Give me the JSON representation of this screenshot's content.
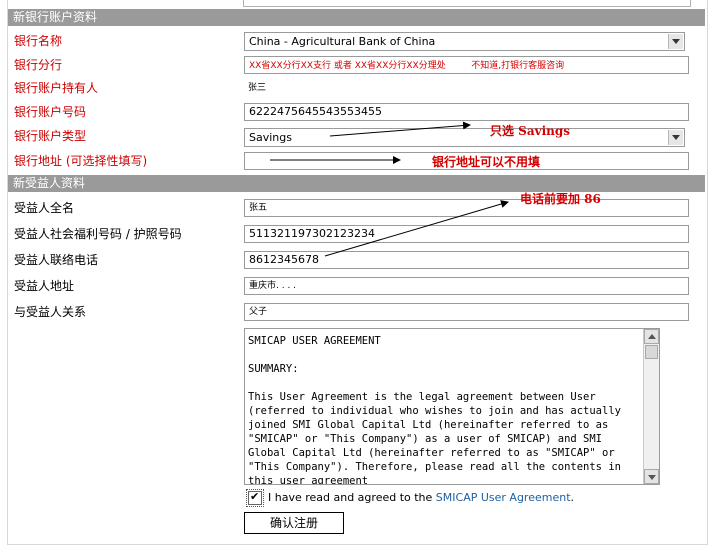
{
  "bank_section": {
    "title": "新银行账户资料",
    "fields": [
      {
        "label": "银行名称",
        "value": "China - Agricultural Bank of China"
      },
      {
        "label": "银行分行",
        "value": "XX省XX分行XX支行  或者   XX省XX分行XX分理处",
        "note": "不知道,打银行客服咨询"
      },
      {
        "label": "银行账户持有人",
        "value": "张三"
      },
      {
        "label": "银行账户号码",
        "value": "6222475645543553455"
      },
      {
        "label": "银行账户类型",
        "value": "Savings"
      },
      {
        "label": "银行地址 (可选择性填写)",
        "value": ""
      }
    ]
  },
  "beneficiary_section": {
    "title": "新受益人资料",
    "fields": [
      {
        "label": "受益人全名",
        "value": "张五"
      },
      {
        "label": "受益人社会福利号码 / 护照号码",
        "value": "511321197302123234"
      },
      {
        "label": "受益人联络电话",
        "value": "8612345678"
      },
      {
        "label": "受益人地址",
        "value": "重庆市. . . ."
      },
      {
        "label": "与受益人关系",
        "value": "父子"
      }
    ]
  },
  "annotations": {
    "savings": "只选 Savings",
    "address": "银行地址可以不用填",
    "phone": "电话前要加 86"
  },
  "agreement": {
    "text": "SMICAP USER AGREEMENT\n\nSUMMARY:\n\nThis User Agreement is the legal agreement between User (referred to individual who wishes to join and has actually joined SMI Global Capital Ltd (hereinafter referred to as \"SMICAP\" or \"This Company\") as a user of SMICAP) and SMI Global Capital Ltd (hereinafter referred to as \"SMICAP\" or \"This Company\"). Therefore, please read all the contents in this user agreement",
    "checkbox_text": "I have read and agreed to the ",
    "link_text": "SMICAP User Agreement",
    "link_suffix": ".",
    "checked": true
  },
  "submit_label": "确认注册",
  "colors": {
    "section_bg": "#9a9a9a",
    "label_red": "#cc0000",
    "annotation_red": "#d40000",
    "link_blue": "#1f5fa0"
  }
}
